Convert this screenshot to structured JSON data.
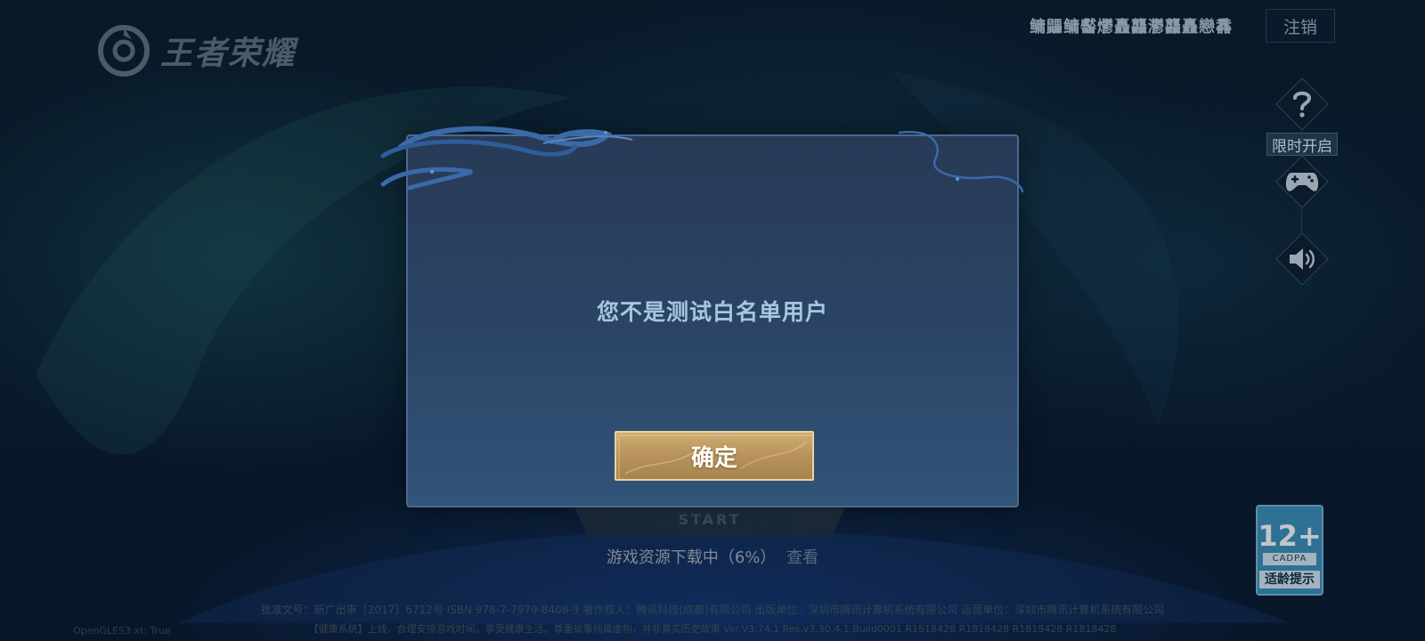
{
  "logo": {
    "text": "王者荣耀",
    "icon": "game-logo-icon"
  },
  "header": {
    "user_name": "鳙鼺鳙齾爩矗龘灪龘矗戀馫",
    "logout_label": "注销"
  },
  "side_buttons": {
    "help_icon": "question-icon",
    "limited_open_label": "限时开启",
    "gamepad_icon": "gamepad-icon",
    "sound_icon": "speaker-icon"
  },
  "dialog": {
    "message": "您不是测试白名单用户",
    "confirm_label": "确定"
  },
  "start": {
    "sub_label": "START"
  },
  "download": {
    "status": "游戏资源下载中（6%）",
    "progress_percent": 6,
    "view_label": "查看"
  },
  "age_badge": {
    "rating": "12+",
    "org": "CADPA",
    "tip": "适龄提示"
  },
  "footer": {
    "line1": "批准文号：新广出审［2017］6712号  ISBN 978-7-7979-8408-9  著作权人：腾讯科技(成都)有限公司  出版单位：深圳市腾讯计算机系统有限公司  运营单位：深圳市腾讯计算机系统有限公司",
    "line2": "【健康系统】上线，合理安排游戏时间，享受健康生活。尊重故事纯属虚构，并非真实历史故事 Ver.V3.74.1 Res.v3.30.4.1 Build0001 R1818428 R1818428 R1818428 R1818428",
    "opengl": "OpenGLES3.xt: True"
  },
  "colors": {
    "dialog_bg": "#2b4567",
    "dialog_border": "#4a6a90",
    "message_text": "#a9c4e0",
    "confirm_gold": "#c19c62"
  }
}
